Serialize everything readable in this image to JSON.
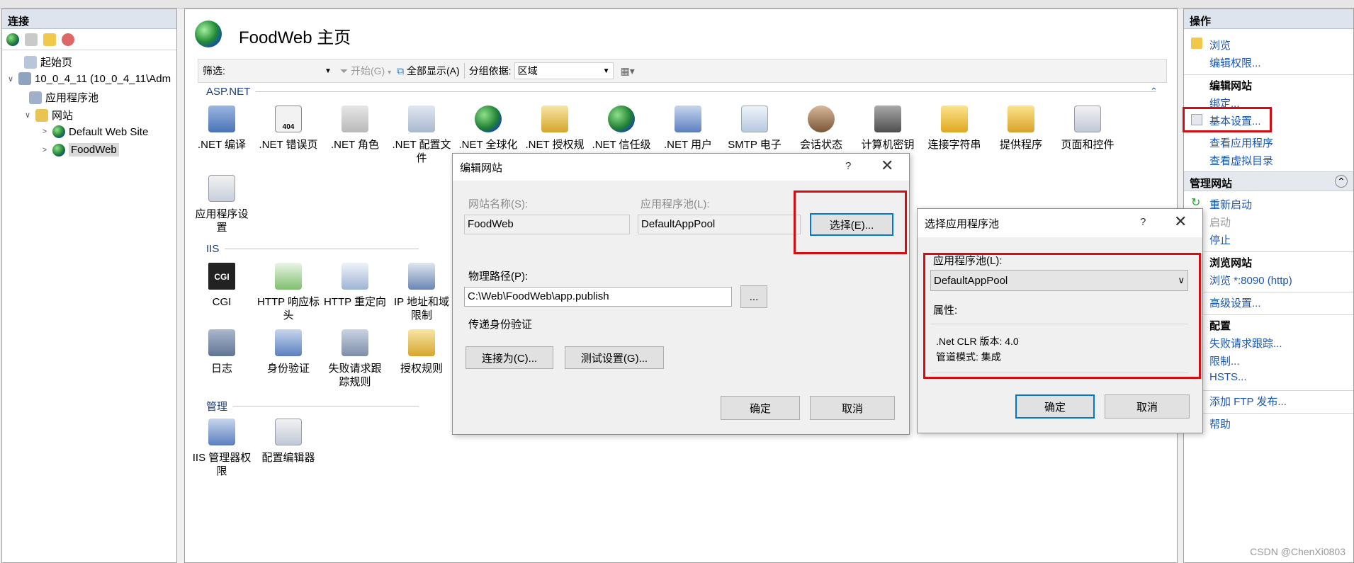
{
  "left_pane": {
    "title": "连接",
    "tree": [
      {
        "label": "起始页"
      },
      {
        "label": "10_0_4_11 (10_0_4_11\\Adm"
      },
      {
        "label": "应用程序池"
      },
      {
        "label": "网站"
      },
      {
        "label": "Default Web Site"
      },
      {
        "label": "FoodWeb"
      }
    ]
  },
  "center": {
    "title": "FoodWeb 主页",
    "filter": {
      "label": "筛选:",
      "go": "开始(G)",
      "show_all": "全部显示(A)",
      "group_label": "分组依据:",
      "group_value": "区域"
    },
    "sections": {
      "aspnet": "ASP.NET",
      "iis": "IIS",
      "manage": "管理"
    },
    "aspnet_features": [
      {
        "line1": ".NET 编译",
        "line2": ""
      },
      {
        "line1": ".NET 错误页",
        "line2": ""
      },
      {
        "line1": ".NET 角色",
        "line2": ""
      },
      {
        "line1": ".NET 配置文",
        "line2": "件"
      },
      {
        "line1": ".NET 全球化",
        "line2": ""
      },
      {
        "line1": ".NET 授权规",
        "line2": ""
      },
      {
        "line1": ".NET 信任级",
        "line2": ""
      },
      {
        "line1": ".NET 用户",
        "line2": ""
      },
      {
        "line1": "SMTP 电子",
        "line2": ""
      },
      {
        "line1": "会话状态",
        "line2": ""
      },
      {
        "line1": "计算机密钥",
        "line2": ""
      },
      {
        "line1": "连接字符串",
        "line2": ""
      },
      {
        "line1": "提供程序",
        "line2": ""
      },
      {
        "line1": "页面和控件",
        "line2": ""
      },
      {
        "line1": "应用程序设",
        "line2": "置"
      }
    ],
    "iis_features": [
      {
        "line1": "CGI",
        "line2": ""
      },
      {
        "line1": "HTTP 响应标",
        "line2": "头"
      },
      {
        "line1": "HTTP 重定向",
        "line2": ""
      },
      {
        "line1": "IP 地址和域",
        "line2": "限制"
      },
      {
        "line1": "日志",
        "line2": ""
      },
      {
        "line1": "身份验证",
        "line2": ""
      },
      {
        "line1": "失败请求跟",
        "line2": "踪规则"
      },
      {
        "line1": "授权规则",
        "line2": ""
      }
    ],
    "manage_features": [
      {
        "line1": "IIS 管理器权",
        "line2": "限"
      },
      {
        "line1": "配置编辑器",
        "line2": ""
      }
    ],
    "cgi_text": "CGI",
    "err_text": "404"
  },
  "right_pane": {
    "title": "操作",
    "browse": "浏览",
    "edit_permissions": "编辑权限...",
    "edit_site_group": "编辑网站",
    "bindings": "绑定...",
    "basic_settings": "基本设置...",
    "view_apps": "查看应用程序",
    "view_vdirs": "查看虚拟目录",
    "manage_site_group": "管理网站",
    "restart": "重新启动",
    "start": "启动",
    "stop": "停止",
    "browse_site_group": "浏览网站",
    "browse_port": "浏览 *:8090 (http)",
    "advanced": "高级设置...",
    "config_group": "配置",
    "failed_tracing": "失败请求跟踪...",
    "limits": "限制...",
    "hsts": "HSTS...",
    "add_ftp": "添加 FTP 发布...",
    "help": "帮助"
  },
  "edit_site_dialog": {
    "title": "编辑网站",
    "site_name_label": "网站名称(S):",
    "site_name": "FoodWeb",
    "app_pool_label": "应用程序池(L):",
    "app_pool": "DefaultAppPool",
    "select_button": "选择(E)...",
    "physical_path_label": "物理路径(P):",
    "physical_path": "C:\\Web\\FoodWeb\\app.publish",
    "browse_button": "...",
    "pass_auth": "传递身份验证",
    "connect_as": "连接为(C)...",
    "test_settings": "测试设置(G)...",
    "ok": "确定",
    "cancel": "取消"
  },
  "select_pool_dialog": {
    "title": "选择应用程序池",
    "pool_label": "应用程序池(L):",
    "pool_value": "DefaultAppPool",
    "props_label": "属性:",
    "clr_version": ".Net CLR 版本: 4.0",
    "pipeline": "管道模式: 集成",
    "ok": "确定",
    "cancel": "取消"
  },
  "watermark": "CSDN @ChenXi0803"
}
